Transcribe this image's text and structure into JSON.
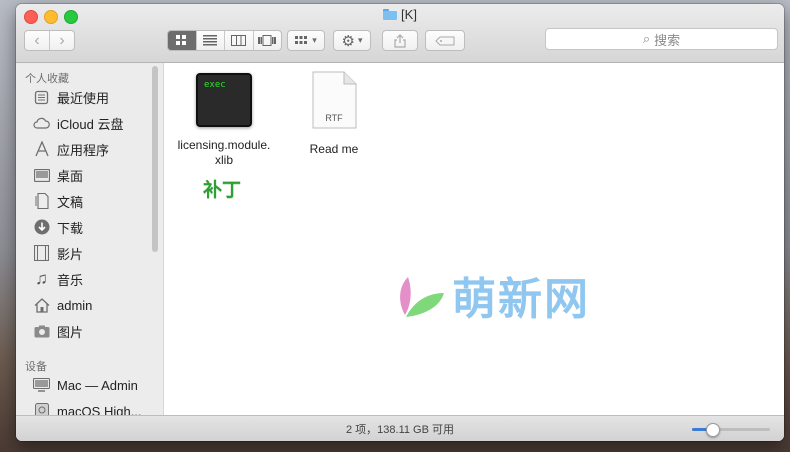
{
  "window": {
    "title": "[K]"
  },
  "search": {
    "placeholder": "搜索"
  },
  "sidebar": {
    "favorites_heading": "个人收藏",
    "favorites": [
      {
        "label": "最近使用",
        "icon": "recents-icon"
      },
      {
        "label": "iCloud 云盘",
        "icon": "cloud-icon"
      },
      {
        "label": "应用程序",
        "icon": "applications-icon"
      },
      {
        "label": "桌面",
        "icon": "desktop-icon"
      },
      {
        "label": "文稿",
        "icon": "documents-icon"
      },
      {
        "label": "下载",
        "icon": "downloads-icon"
      },
      {
        "label": "影片",
        "icon": "movies-icon"
      },
      {
        "label": "音乐",
        "icon": "music-icon"
      },
      {
        "label": "admin",
        "icon": "home-icon"
      },
      {
        "label": "图片",
        "icon": "pictures-icon"
      }
    ],
    "devices_heading": "设备",
    "devices": [
      {
        "label": "Mac — Admin",
        "icon": "computer-icon"
      },
      {
        "label": "macOS High...",
        "icon": "disk-icon"
      }
    ]
  },
  "files": [
    {
      "name": "licensing.module.\nxlib",
      "icon_text": "exec",
      "type": "executable"
    },
    {
      "name": "Read me",
      "icon_text": "RTF",
      "type": "rtf-document"
    }
  ],
  "annotation": {
    "patch_label": "补丁"
  },
  "watermark": {
    "text": "萌新网"
  },
  "statusbar": {
    "text": "2 项，138.11 GB 可用",
    "zoom_level": 0.25
  },
  "colors": {
    "accent": "#3a7bd5",
    "watermark": "#8fc7f0",
    "patch": "#2f9e36"
  }
}
